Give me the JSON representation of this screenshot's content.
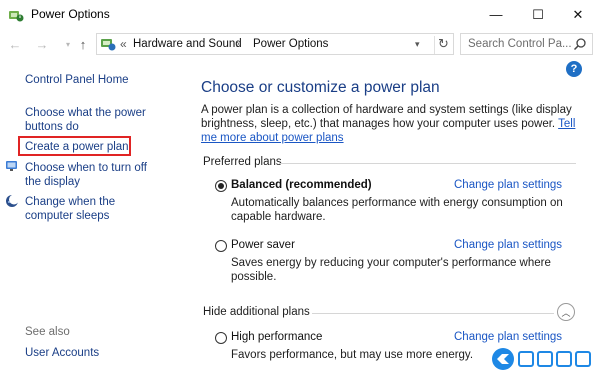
{
  "window": {
    "title": "Power Options",
    "minimize_glyph": "—",
    "maximize_glyph": "☐",
    "close_glyph": "✕"
  },
  "address": {
    "back_glyph": "←",
    "forward_glyph": "→",
    "recent_glyph": "▾",
    "up_glyph": "↑",
    "chevron": "«",
    "crumbs": [
      "Hardware and Sound",
      "Power Options"
    ],
    "separator": "›",
    "dropdown_glyph": "▾",
    "refresh_glyph": "↻",
    "search_placeholder": "Search Control Pa..."
  },
  "help_glyph": "?",
  "sidebar": {
    "home": "Control Panel Home",
    "items": [
      "Choose what the power buttons do",
      "Create a power plan",
      "Choose when to turn off the display",
      "Change when the computer sleeps"
    ],
    "see_also": "See also",
    "see_also_items": [
      "User Accounts"
    ]
  },
  "main": {
    "title": "Choose or customize a power plan",
    "intro": "A power plan is a collection of hardware and system settings (like display brightness, sleep, etc.) that manages how your computer uses power.",
    "intro_link": "Tell me more about power plans",
    "preferred_label": "Preferred plans",
    "hide_label": "Hide additional plans",
    "collapse_glyph": "︿",
    "change_label": "Change plan settings",
    "plans": [
      {
        "name": "Balanced (recommended)",
        "selected": true,
        "description": "Automatically balances performance with energy consumption on capable hardware."
      },
      {
        "name": "Power saver",
        "selected": false,
        "description": "Saves energy by reducing your computer's performance where possible."
      },
      {
        "name": "High performance",
        "selected": false,
        "description": "Favors performance, but may use more energy."
      }
    ]
  },
  "colors": {
    "link": "#1a56c4",
    "heading": "#1a3e86",
    "highlight_box": "#e02424"
  }
}
